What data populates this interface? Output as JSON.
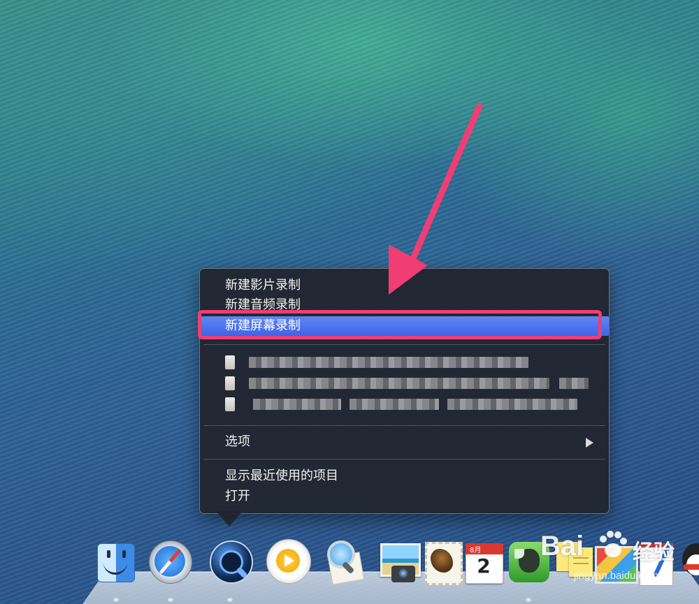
{
  "context_menu": {
    "items_top": [
      {
        "label": "新建影片录制"
      },
      {
        "label": "新建音频录制"
      },
      {
        "label": "新建屏幕录制",
        "selected": true
      }
    ],
    "options_label": "选项",
    "show_recent_label": "显示最近使用的项目",
    "open_label": "打开"
  },
  "dock": {
    "apps": [
      {
        "name": "Finder",
        "icon": "finder-icon"
      },
      {
        "name": "Safari",
        "icon": "safari-icon"
      },
      {
        "name": "QuickTime Player",
        "icon": "quicktime-icon",
        "active": true
      },
      {
        "name": "Media Player",
        "icon": "media-player-icon"
      },
      {
        "name": "Preview",
        "icon": "preview-icon"
      },
      {
        "name": "iPhoto",
        "icon": "iphoto-icon"
      },
      {
        "name": "Mail",
        "icon": "mail-icon"
      },
      {
        "name": "Calendar",
        "icon": "calendar-icon"
      },
      {
        "name": "Evernote",
        "icon": "evernote-icon"
      },
      {
        "name": "Stickies",
        "icon": "stickies-icon"
      },
      {
        "name": "Photo Booth",
        "icon": "photo-booth-icon"
      },
      {
        "name": "TextEdit",
        "icon": "textedit-icon"
      },
      {
        "name": "QQ",
        "icon": "qq-icon"
      }
    ],
    "calendar_month": "8月",
    "calendar_day": "2"
  },
  "watermark": {
    "logo": "Bai",
    "cn": "经验",
    "url": "jingyan.baidu.com"
  },
  "colors": {
    "menu_bg": "#20242c",
    "selection": "#4a72ee",
    "annotation": "#f03d74"
  }
}
